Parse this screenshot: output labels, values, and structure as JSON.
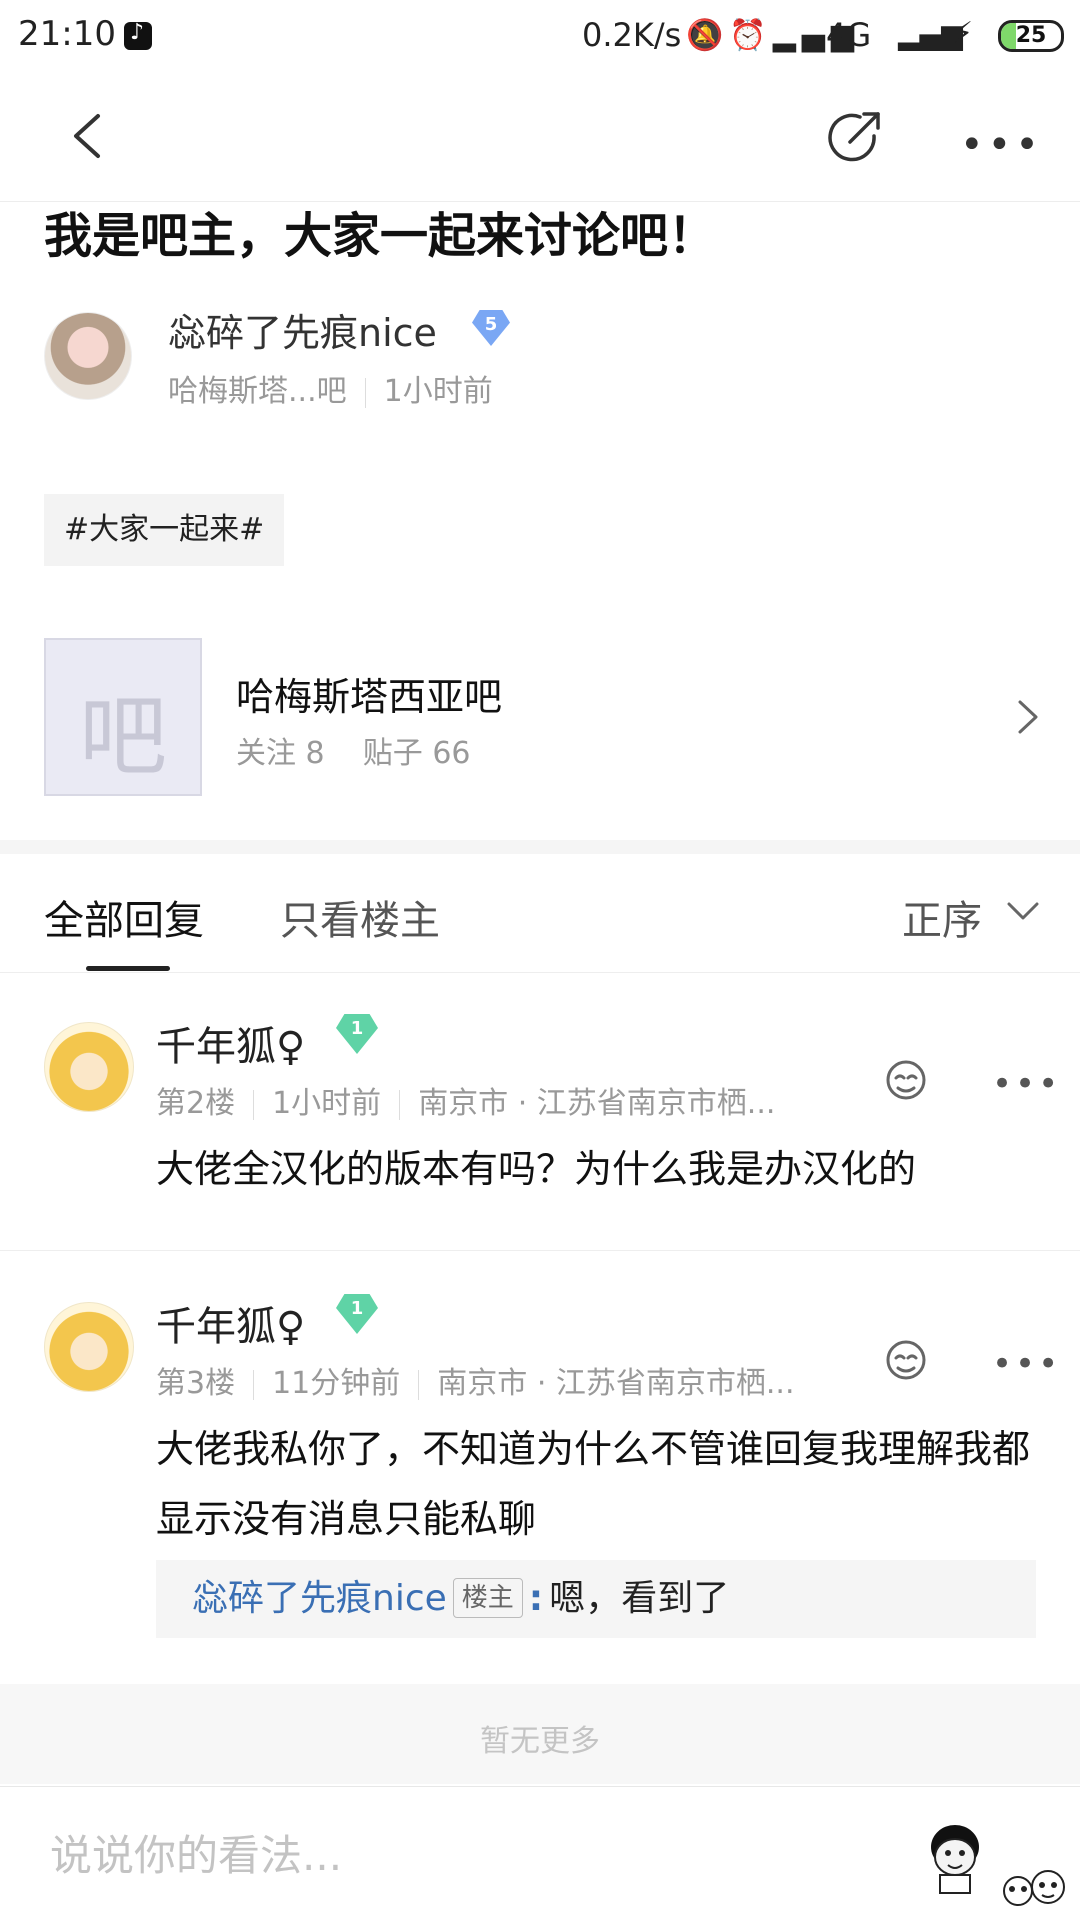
{
  "status_bar": {
    "time": "21:10",
    "net_speed": "0.2K/s",
    "network": "4G",
    "battery": "25",
    "battery_fraction": 0.25
  },
  "nav": {
    "back_icon": "chevron-left-icon",
    "share_icon": "share-arrow-icon",
    "more_icon": "more-horizontal-icon"
  },
  "post": {
    "title": "我是吧主，大家一起来讨论吧！",
    "author": "惢碎了先痕nice",
    "author_level": "5",
    "forum_short": "哈梅斯塔...吧",
    "time": "1小时前",
    "tag": "#大家一起来#"
  },
  "forum": {
    "thumb_char": "吧",
    "name": "哈梅斯塔西亚吧",
    "follows": "关注 8",
    "posts": "贴子 66"
  },
  "tabs": {
    "all": "全部回复",
    "op_only": "只看楼主",
    "sort": "正序"
  },
  "replies": [
    {
      "name": "千年狐♀",
      "level": "1",
      "floor": "第2楼",
      "time": "1小时前",
      "location": "南京市 · 江苏省南京市栖...",
      "text": "大佬全汉化的版本有吗？为什么我是办汉化的"
    },
    {
      "name": "千年狐♀",
      "level": "1",
      "floor": "第3楼",
      "time": "11分钟前",
      "location": "南京市 · 江苏省南京市栖...",
      "text": "大佬我私你了，不知道为什么不管谁回复我理解我都显示没有消息只能私聊",
      "sub_reply": {
        "name": "惢碎了先痕nice",
        "tag": "楼主",
        "text": "嗯，看到了"
      }
    }
  ],
  "no_more": "暂无更多",
  "input": {
    "placeholder": "说说你的看法..."
  },
  "colors": {
    "link_blue": "#3a6fb4",
    "level1_green": "#5fd3a6",
    "level5_blue": "#7aa7f4",
    "battery_green": "#7fd86a"
  }
}
